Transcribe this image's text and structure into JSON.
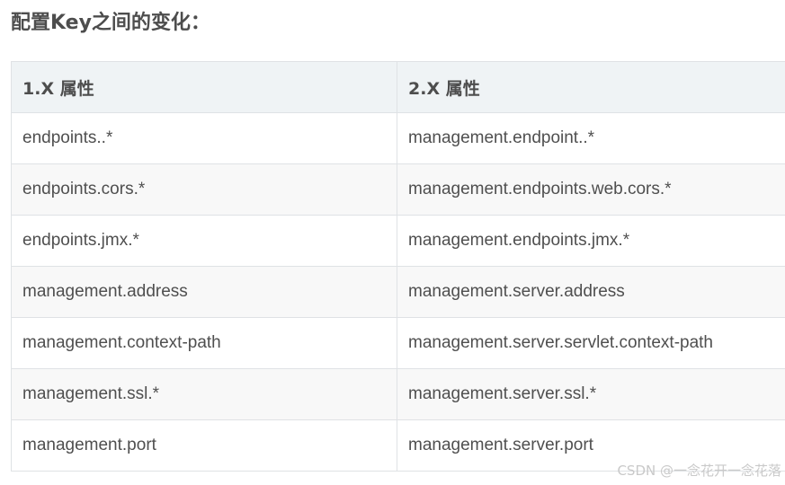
{
  "heading": "配置Key之间的变化：",
  "table": {
    "headers": [
      "1.X 属性",
      "2.X 属性"
    ],
    "rows": [
      [
        "endpoints..*",
        "management.endpoint..*"
      ],
      [
        "endpoints.cors.*",
        "management.endpoints.web.cors.*"
      ],
      [
        "endpoints.jmx.*",
        "management.endpoints.jmx.*"
      ],
      [
        "management.address",
        "management.server.address"
      ],
      [
        "management.context-path",
        "management.server.servlet.context-path"
      ],
      [
        "management.ssl.*",
        "management.server.ssl.*"
      ],
      [
        "management.port",
        "management.server.port"
      ]
    ]
  },
  "watermark": "CSDN @一念花开一念花落"
}
